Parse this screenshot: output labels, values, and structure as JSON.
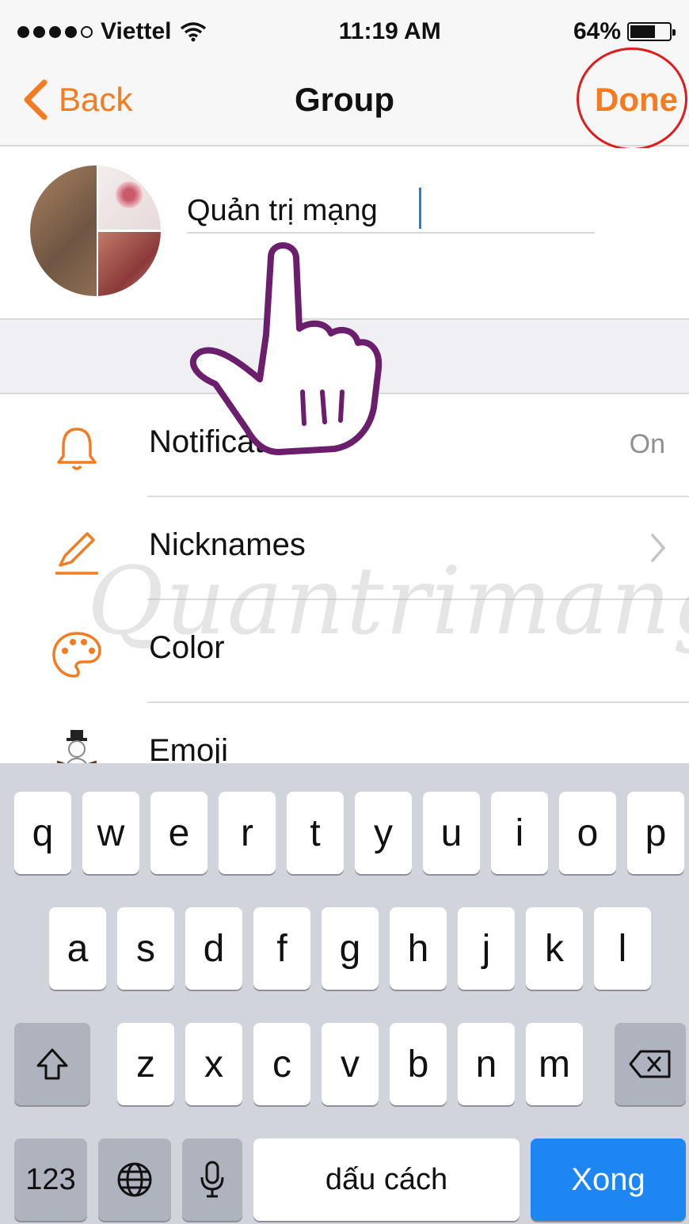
{
  "status": {
    "carrier": "Viettel",
    "time": "11:19 AM",
    "battery_percent": "64%",
    "battery_level": 0.64,
    "signal_bars": 4,
    "signal_total": 5
  },
  "nav": {
    "back_label": "Back",
    "title": "Group",
    "done_label": "Done",
    "accent_color": "#f47b20",
    "highlight_circle_color": "#e01b1b"
  },
  "group": {
    "name_value": "Quản trị mạng"
  },
  "settings": [
    {
      "label": "Notifications",
      "value": "On",
      "icon": "bell-icon"
    },
    {
      "label": "Nicknames",
      "value": "",
      "icon": "pencil-icon",
      "chevron": true
    },
    {
      "label": "Color",
      "value": "",
      "icon": "palette-icon"
    },
    {
      "label": "Emoji",
      "value": "",
      "icon": "snowman-emoji-icon"
    }
  ],
  "watermark": "Quantrimang",
  "keyboard": {
    "row1": [
      "q",
      "w",
      "e",
      "r",
      "t",
      "y",
      "u",
      "i",
      "o",
      "p"
    ],
    "row2": [
      "a",
      "s",
      "d",
      "f",
      "g",
      "h",
      "j",
      "k",
      "l"
    ],
    "row3": [
      "z",
      "x",
      "c",
      "v",
      "b",
      "n",
      "m"
    ],
    "numbers_label": "123",
    "space_label": "dấu cách",
    "return_label": "Xong",
    "return_color": "#1e86f3"
  }
}
